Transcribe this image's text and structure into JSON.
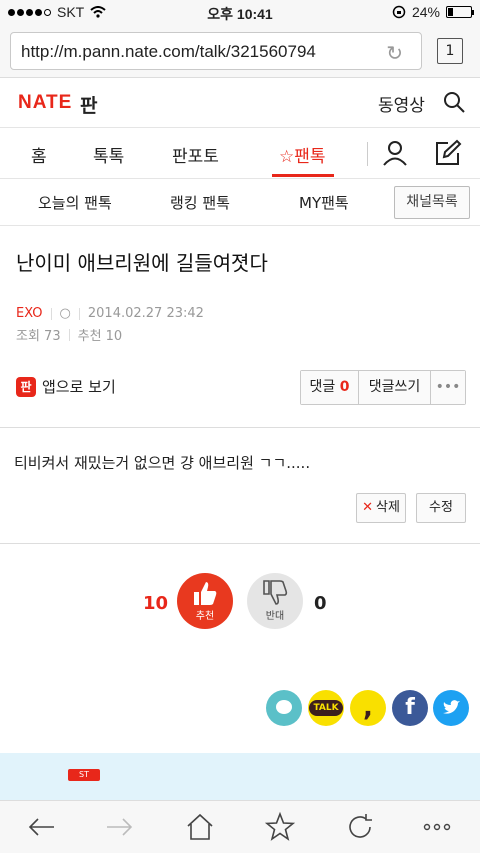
{
  "status": {
    "carrier": "SKT",
    "time": "오후 10:41",
    "battery": "24%",
    "battery_level": 0.24
  },
  "browser": {
    "url": "http://m.pann.nate.com/talk/321560794",
    "tab_count": "1"
  },
  "site": {
    "logo": "NATE",
    "section": "판",
    "video_link": "동영상"
  },
  "nav": {
    "home": "홈",
    "toktok": "톡톡",
    "panpoto": "판포토",
    "pantalk": "팬톡"
  },
  "subnav": {
    "today": "오늘의 팬톡",
    "ranking": "랭킹 팬톡",
    "my": "MY팬톡",
    "channels": "채널목록"
  },
  "post": {
    "title": "난이미 애브리원에 길들여졋다",
    "category": "EXO",
    "circle": "○",
    "date": "2014.02.27 23:42",
    "views": "조회 73",
    "recommends": "추천 10",
    "body": "티비켜서 재밌는거 없으면 걍 애브리원 ㄱㄱ....."
  },
  "actions": {
    "app_view": "앱으로 보기",
    "app_icon": "판",
    "comments_label": "댓글",
    "comments_count": "0",
    "write_comment": "댓글쓰기",
    "more": "•••",
    "delete": "삭제",
    "edit": "수정"
  },
  "votes": {
    "up_count": "10",
    "up_label": "추천",
    "down_label": "반대",
    "down_count": "0"
  },
  "share": {
    "talk": "TALK"
  },
  "banner": {
    "badge": "ST"
  },
  "colors": {
    "accent": "#e8271a",
    "kakao": "#f9e000",
    "facebook": "#3b5998",
    "twitter": "#1da1f2",
    "bubble": "#5bc0c8"
  }
}
